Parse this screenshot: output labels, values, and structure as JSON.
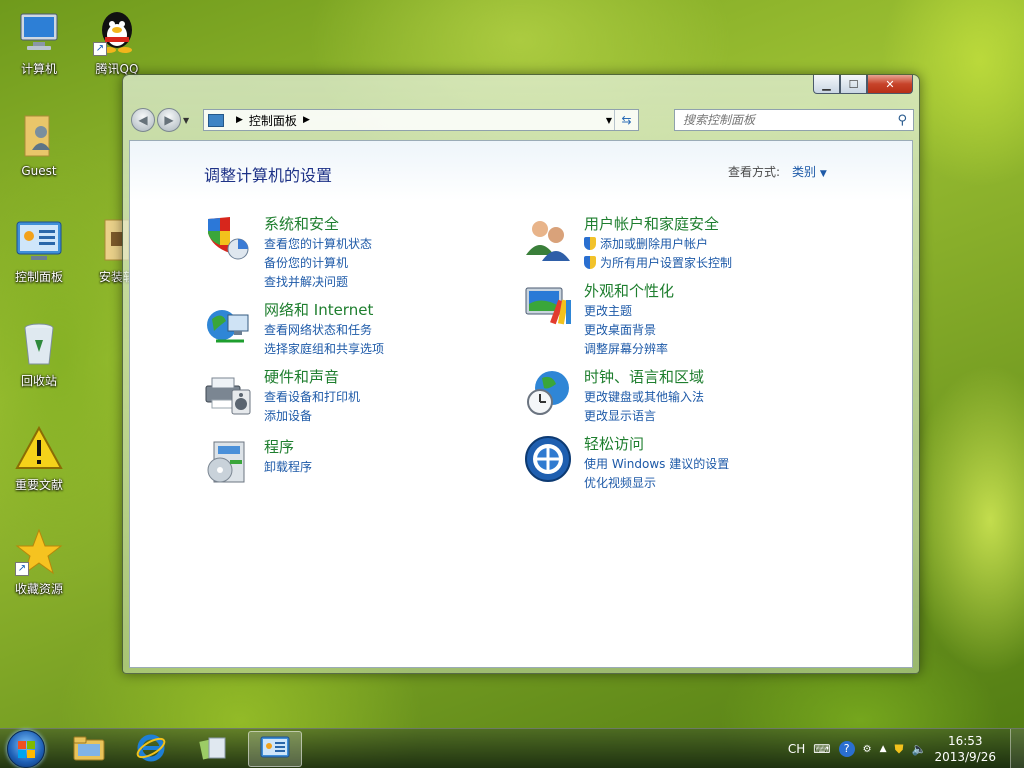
{
  "desktop": {
    "icons": [
      {
        "label": "计算机"
      },
      {
        "label": "腾讯QQ"
      },
      {
        "label": "Guest"
      },
      {
        "label": "控制面板"
      },
      {
        "label": "安装软"
      },
      {
        "label": "回收站"
      },
      {
        "label": "重要文献"
      },
      {
        "label": "收藏资源"
      }
    ]
  },
  "window": {
    "address": {
      "root_icon": "control-panel-icon",
      "path": [
        "控制面板"
      ]
    },
    "search": {
      "placeholder": "搜索控制面板"
    },
    "heading": "调整计算机的设置",
    "view_by_label": "查看方式:",
    "view_by_value": "类别",
    "categories": [
      {
        "icon": "system-security-icon",
        "title": "系统和安全",
        "links": [
          {
            "text": "查看您的计算机状态"
          },
          {
            "text": "备份您的计算机"
          },
          {
            "text": "查找并解决问题"
          }
        ]
      },
      {
        "icon": "user-accounts-icon",
        "title": "用户帐户和家庭安全",
        "links": [
          {
            "text": "添加或删除用户帐户",
            "shield": true
          },
          {
            "text": "为所有用户设置家长控制",
            "shield": true
          }
        ]
      },
      {
        "icon": "network-internet-icon",
        "title": "网络和 Internet",
        "links": [
          {
            "text": "查看网络状态和任务"
          },
          {
            "text": "选择家庭组和共享选项"
          }
        ]
      },
      {
        "icon": "appearance-icon",
        "title": "外观和个性化",
        "links": [
          {
            "text": "更改主题"
          },
          {
            "text": "更改桌面背景"
          },
          {
            "text": "调整屏幕分辨率"
          }
        ]
      },
      {
        "icon": "hardware-sound-icon",
        "title": "硬件和声音",
        "links": [
          {
            "text": "查看设备和打印机"
          },
          {
            "text": "添加设备"
          }
        ]
      },
      {
        "icon": "clock-region-icon",
        "title": "时钟、语言和区域",
        "links": [
          {
            "text": "更改键盘或其他输入法"
          },
          {
            "text": "更改显示语言"
          }
        ]
      },
      {
        "icon": "programs-icon",
        "title": "程序",
        "links": [
          {
            "text": "卸载程序"
          }
        ]
      },
      {
        "icon": "ease-of-access-icon",
        "title": "轻松访问",
        "links": [
          {
            "text": "使用 Windows 建议的设置"
          },
          {
            "text": "优化视频显示"
          }
        ]
      }
    ]
  },
  "taskbar": {
    "tray": {
      "language": "CH"
    },
    "clock": {
      "time": "16:53",
      "date": "2013/9/26"
    }
  }
}
